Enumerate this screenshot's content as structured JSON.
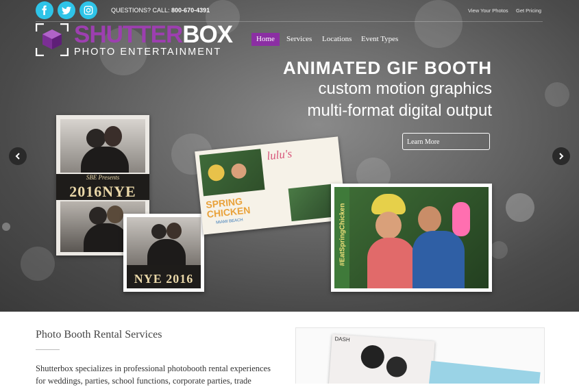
{
  "topbar": {
    "call_label": "QUESTIONS? CALL:",
    "phone": "800-670-4391",
    "links": [
      "View Your Photos",
      "Get Pricing"
    ],
    "social_icons": [
      "facebook-icon",
      "twitter-icon",
      "instagram-icon"
    ],
    "accent_color": "#2ec4e8"
  },
  "logo": {
    "word_purple": "SHUTTER",
    "word_white": "BOX",
    "tagline": "PHOTO ENTERTAINMENT",
    "brand_color": "#9d3fb0"
  },
  "nav": {
    "items": [
      "Home",
      "Services",
      "Locations",
      "Event Types"
    ],
    "active": "Home"
  },
  "hero": {
    "headline": "ANIMATED GIF BOOTH",
    "line2": "custom motion graphics",
    "line3": "multi-format digital output",
    "cta": "Learn More",
    "print_texts": {
      "nye_large": "2016NYE",
      "nye_small": "NYE 2016",
      "sbe": "SBE Presents",
      "hashtag": "#EatSpringChicken",
      "spring": "SPRING CHICKEN",
      "miami": "MIAMI BEACH",
      "lulus": "lulu's"
    }
  },
  "content": {
    "title": "Photo Booth Rental Services",
    "paragraph": "Shutterbox specializes in professional photobooth rental experiences for weddings, parties, school functions, corporate parties, trade",
    "panel_caption": "DASH"
  }
}
